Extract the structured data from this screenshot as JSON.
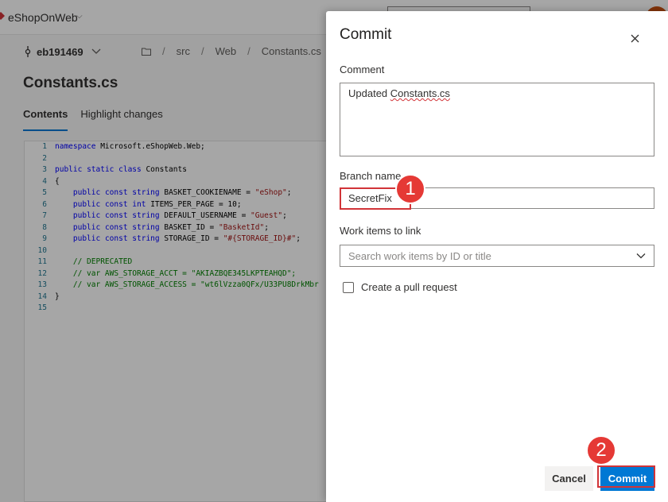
{
  "topbar": {
    "project_name": "eShopOnWeb"
  },
  "repo": {
    "branch": "eb191469",
    "breadcrumb": [
      "src",
      "Web",
      "Constants.cs"
    ],
    "file_title": "Constants.cs",
    "tabs": [
      "Contents",
      "Highlight changes"
    ]
  },
  "code": {
    "lines": [
      {
        "n": "1",
        "text": "namespace Microsoft.eShopWeb.Web;"
      },
      {
        "n": "2",
        "text": ""
      },
      {
        "n": "3",
        "text": "public static class Constants"
      },
      {
        "n": "4",
        "text": "{"
      },
      {
        "n": "5",
        "text": "    public const string BASKET_COOKIENAME = \"eShop\";"
      },
      {
        "n": "6",
        "text": "    public const int ITEMS_PER_PAGE = 10;"
      },
      {
        "n": "7",
        "text": "    public const string DEFAULT_USERNAME = \"Guest\";"
      },
      {
        "n": "8",
        "text": "    public const string BASKET_ID = \"BasketId\";"
      },
      {
        "n": "9",
        "text": "    public const string STORAGE_ID = \"#{STORAGE_ID}#\";"
      },
      {
        "n": "10",
        "text": ""
      },
      {
        "n": "11",
        "text": "    // DEPRECATED"
      },
      {
        "n": "12",
        "text": "    // var AWS_STORAGE_ACCT = \"AKIAZBQE345LKPTEAHQD\";"
      },
      {
        "n": "13",
        "text": "    // var AWS_STORAGE_ACCESS = \"wt6lVzza0QFx/U33PU8DrkMbr"
      },
      {
        "n": "14",
        "text": "}"
      },
      {
        "n": "15",
        "text": ""
      }
    ]
  },
  "dialog": {
    "title": "Commit",
    "comment_label": "Comment",
    "comment_word_1": "Updated",
    "comment_word_2": "Constants.cs",
    "branch_label": "Branch name",
    "branch_value": "SecretFix",
    "workitems_label": "Work items to link",
    "workitems_placeholder": "Search work items by ID or title",
    "pr_label": "Create a pull request",
    "cancel_label": "Cancel",
    "commit_label": "Commit"
  },
  "annotations": {
    "step1": "1",
    "step2": "2"
  },
  "colors": {
    "accent": "#0078d4",
    "highlight": "#d13438",
    "badge": "#e53935"
  }
}
